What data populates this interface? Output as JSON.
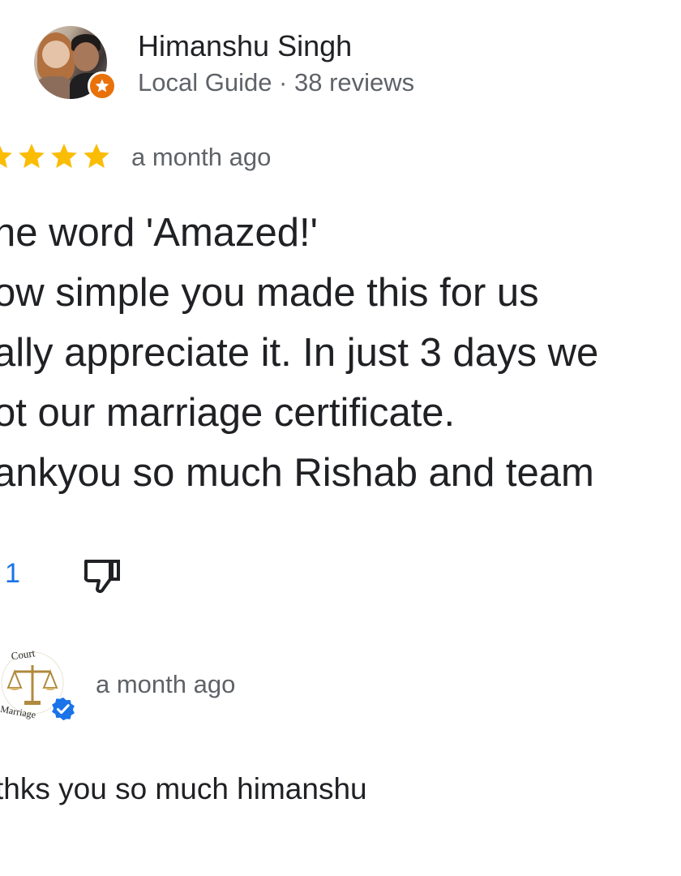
{
  "reviewer": {
    "name": "Himanshu Singh",
    "meta": "Local Guide · 38 reviews"
  },
  "review": {
    "rating": 5,
    "date": "a month ago",
    "lines": [
      "he word 'Amazed!'",
      "ow simple you made this for us",
      "ally appreciate it. In just 3 days we",
      "ot our marriage certificate.",
      "ankyou so much Rishab and team"
    ],
    "like_count": "1"
  },
  "owner": {
    "logo_text_top": "Court",
    "logo_text_bottom": "Marriage",
    "date": "a month ago",
    "reply": "thks you so much himanshu"
  },
  "colors": {
    "star": "#fbbc04",
    "like": "#1a73e8",
    "guide_badge": "#e8710a",
    "verified": "#1a73e8"
  },
  "icons": [
    "star-icon",
    "thumbs-down-icon",
    "local-guide-badge-icon",
    "verified-check-icon"
  ]
}
